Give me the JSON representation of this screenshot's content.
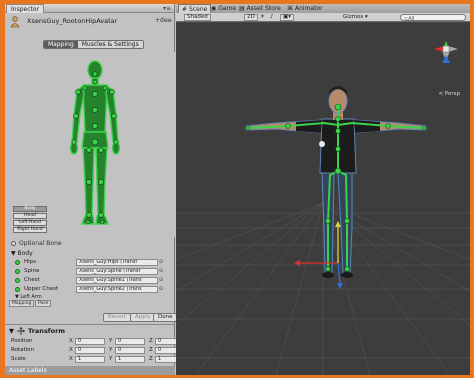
{
  "inspector": {
    "tab_label": "Inspector",
    "title": "XsensGuy_RootonHipAvatar",
    "mini_labels": [
      "+de",
      "≡"
    ],
    "mode_tabs": [
      "Mapping",
      "Muscles & Settings"
    ],
    "active_mode": "Mapping",
    "body_buttons": [
      "Body",
      "Head",
      "Left Hand",
      "Right Hand"
    ],
    "selected_body_button": "Body",
    "optional_bone_label": "Optional Bone",
    "section_label": "▼ Body",
    "bones": [
      {
        "name": "Hips",
        "field": "Xsens_Guy:Hips (Transf"
      },
      {
        "name": "Spine",
        "field": "Xsens_Guy:Spine (Transf"
      },
      {
        "name": "Chest",
        "field": "Xsens_Guy:Spine1 (Trans"
      },
      {
        "name": "Upper Chest",
        "field": "Xsens_Guy:Spine2 (Trans"
      }
    ],
    "bone_picker_glyph": "⊙",
    "more_bones_label": "▼ Left Arm",
    "bottom_tabs": [
      "Mapping",
      "Pose"
    ],
    "revert_label": "Revert",
    "apply_label": "Apply",
    "done_label": "Done",
    "transform": {
      "title": "Transform",
      "rows": [
        {
          "label": "Position",
          "x": "0",
          "y": "0",
          "z": "0"
        },
        {
          "label": "Rotation",
          "x": "0",
          "y": "0",
          "z": "0"
        },
        {
          "label": "Scale",
          "x": "1",
          "y": "1",
          "z": "1"
        }
      ]
    },
    "asset_labels": "Asset Labels"
  },
  "scene": {
    "tabs": [
      "Scene",
      "Game",
      "Asset Store",
      "Animator"
    ],
    "active_tab": "Scene",
    "shading_mode": "Shaded",
    "toolbar_mode": "2D",
    "gizmos_label": "Gizmos ▾",
    "search_placeholder": "⊂All",
    "projection_label": "≺ Persp"
  },
  "colors": {
    "accent_orange": "#e8761f",
    "bone_green": "#3bd34a",
    "viewport_bg": "#3d3d3d"
  }
}
